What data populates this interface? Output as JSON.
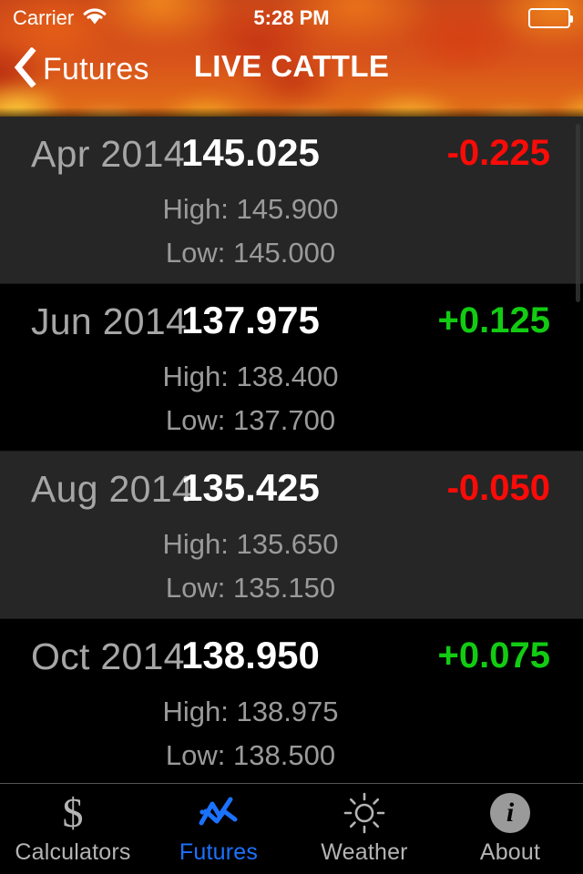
{
  "status_bar": {
    "carrier": "Carrier",
    "time": "5:28 PM",
    "wifi_icon": "wifi-icon",
    "battery_icon": "battery-full-icon"
  },
  "nav": {
    "back_label": "Futures",
    "back_icon": "chevron-left-icon",
    "title": "LIVE CATTLE"
  },
  "colors": {
    "up": "#12cc12",
    "down": "#fb0b07",
    "accent": "#1b72ff",
    "row_alt_bg": "#262626",
    "row_bg": "#000000"
  },
  "labels": {
    "high": "High:",
    "low": "Low:"
  },
  "quotes": [
    {
      "contract": "Apr 2014",
      "last": "145.025",
      "change": "-0.225",
      "direction": "down",
      "high": "145.900",
      "low": "145.000"
    },
    {
      "contract": "Jun 2014",
      "last": "137.975",
      "change": "+0.125",
      "direction": "up",
      "high": "138.400",
      "low": "137.700"
    },
    {
      "contract": "Aug 2014",
      "last": "135.425",
      "change": "-0.050",
      "direction": "down",
      "high": "135.650",
      "low": "135.150"
    },
    {
      "contract": "Oct 2014",
      "last": "138.950",
      "change": "+0.075",
      "direction": "up",
      "high": "138.975",
      "low": "138.500"
    }
  ],
  "tabs": [
    {
      "label": "Calculators",
      "icon": "dollar-sign-icon",
      "active": false
    },
    {
      "label": "Futures",
      "icon": "line-chart-icon",
      "active": true
    },
    {
      "label": "Weather",
      "icon": "sun-icon",
      "active": false
    },
    {
      "label": "About",
      "icon": "info-circle-icon",
      "active": false
    }
  ]
}
